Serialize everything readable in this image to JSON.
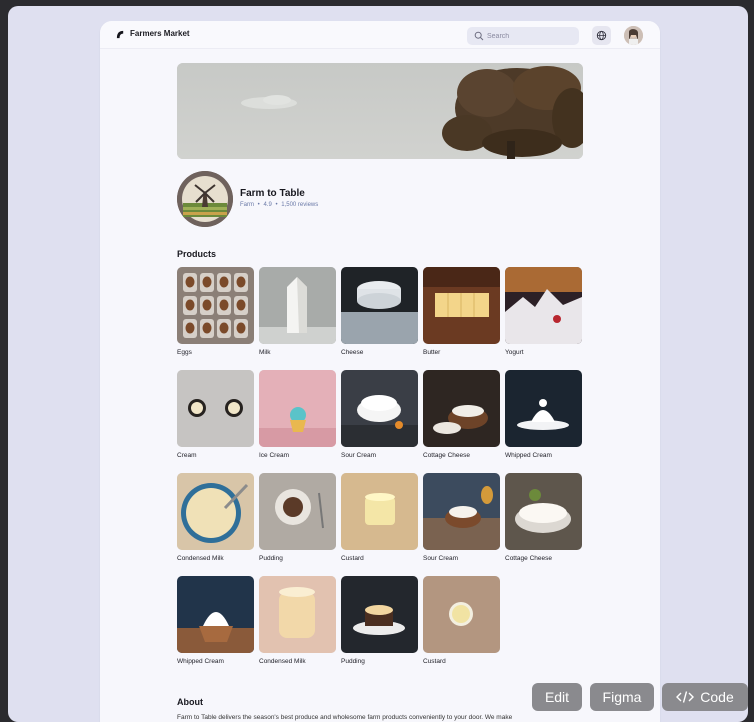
{
  "app": {
    "title": "Farmers Market"
  },
  "search": {
    "placeholder": "Search"
  },
  "shop": {
    "name": "Farm to Table",
    "category": "Farm",
    "rating": "4.9",
    "reviews": "1,500 reviews",
    "separator": "•"
  },
  "sections": {
    "products": "Products",
    "about": "About"
  },
  "products": [
    {
      "label": "Eggs",
      "image": "eggs"
    },
    {
      "label": "Milk",
      "image": "milk"
    },
    {
      "label": "Cheese",
      "image": "cheese"
    },
    {
      "label": "Butter",
      "image": "butter"
    },
    {
      "label": "Yogurt",
      "image": "yogurt"
    },
    {
      "label": "Cream",
      "image": "cream"
    },
    {
      "label": "Ice Cream",
      "image": "ice-cream"
    },
    {
      "label": "Sour Cream",
      "image": "sour-cream"
    },
    {
      "label": "Cottage Cheese",
      "image": "cottage-cheese"
    },
    {
      "label": "Whipped Cream",
      "image": "whipped-cream"
    },
    {
      "label": "Condensed Milk",
      "image": "condensed-milk"
    },
    {
      "label": "Pudding",
      "image": "pudding"
    },
    {
      "label": "Custard",
      "image": "custard"
    },
    {
      "label": "Sour Cream",
      "image": "sour-cream-2"
    },
    {
      "label": "Cottage Cheese",
      "image": "cottage-cheese-2"
    },
    {
      "label": "Whipped Cream",
      "image": "whipped-cream-2"
    },
    {
      "label": "Condensed Milk",
      "image": "condensed-milk-2"
    },
    {
      "label": "Pudding",
      "image": "pudding-2"
    },
    {
      "label": "Custard",
      "image": "custard-2"
    }
  ],
  "about": {
    "text": "Farm to Table delivers the season's best produce and wholesome farm products conveniently to your door. We make"
  },
  "toolbar": {
    "edit": "Edit",
    "figma": "Figma",
    "code": "Code"
  },
  "colors": {
    "accent": "#6b7aa8",
    "float_button": "#8a8a8e",
    "canvas": "#dfe0f0"
  }
}
